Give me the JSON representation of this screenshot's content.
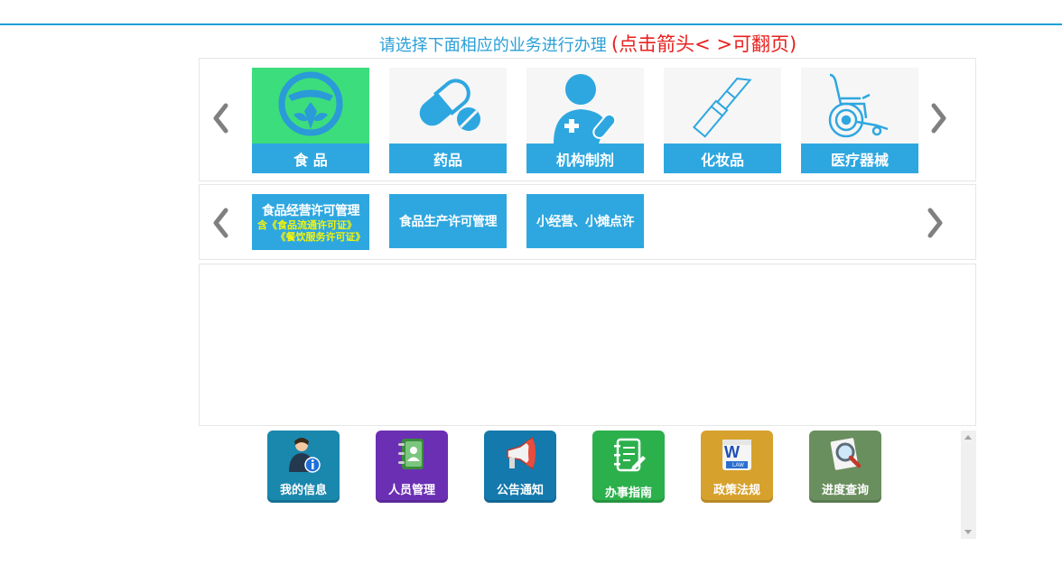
{
  "instruction": {
    "main": "请选择下面相应的业务进行办理",
    "hint": "(点击箭头<  >可翻页)"
  },
  "categories": [
    {
      "label": "食 品",
      "icon": "food-safety-icon",
      "highlight": "#3cdd7c"
    },
    {
      "label": "药品",
      "icon": "pills-icon"
    },
    {
      "label": "机构制剂",
      "icon": "medical-person-icon"
    },
    {
      "label": "化妆品",
      "icon": "lipstick-icon"
    },
    {
      "label": "医疗器械",
      "icon": "wheelchair-icon"
    }
  ],
  "subcategories": [
    {
      "title": "食品经营许可管理",
      "note1": "含《食品流通许可证》",
      "note2": "《餐饮服务许可证》"
    },
    {
      "title": "食品生产许可管理"
    },
    {
      "title": "小经营、小摊点许"
    }
  ],
  "apps": [
    {
      "label": "我的信息",
      "icon": "user-info-icon",
      "color": "#1a87ad"
    },
    {
      "label": "人员管理",
      "icon": "address-book-icon",
      "color": "#6b2fb4"
    },
    {
      "label": "公告通知",
      "icon": "megaphone-icon",
      "color": "#1479ac"
    },
    {
      "label": "办事指南",
      "icon": "notebook-icon",
      "color": "#2cb04c"
    },
    {
      "label": "政策法规",
      "icon": "law-book-icon",
      "color": "#d7a12d"
    },
    {
      "label": "进度查询",
      "icon": "search-document-icon",
      "color": "#6a8f5e"
    }
  ],
  "colors": {
    "accent": "#2ea7e0",
    "hint": "#e8211f",
    "food_tile": "#3cdd7c"
  }
}
